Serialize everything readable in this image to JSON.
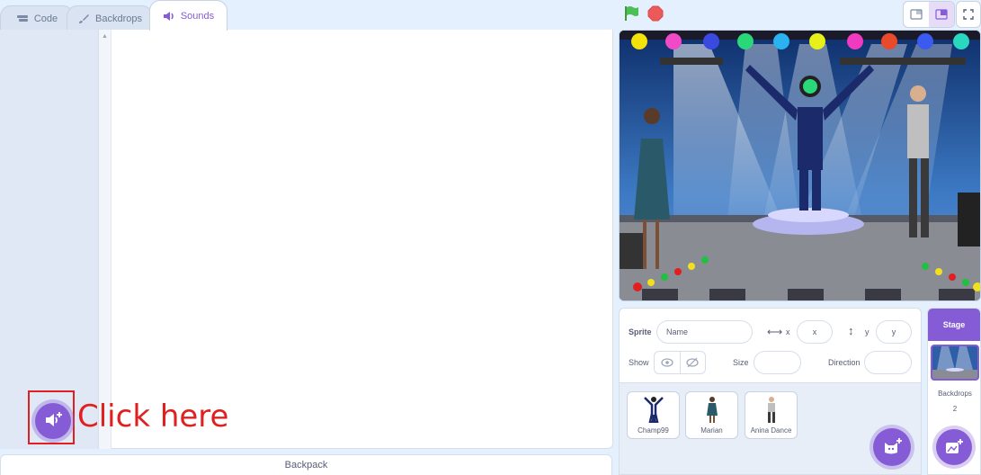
{
  "tabs": [
    {
      "label": "Code",
      "icon": "code-icon"
    },
    {
      "label": "Backdrops",
      "icon": "brush-icon"
    },
    {
      "label": "Sounds",
      "icon": "speaker-icon"
    }
  ],
  "active_tab": "Sounds",
  "annotation": {
    "text": "Click here",
    "color": "#e02020"
  },
  "backpack": {
    "label": "Backpack"
  },
  "sprite_info": {
    "sprite_label": "Sprite",
    "name_placeholder": "Name",
    "x_label": "x",
    "x_placeholder": "x",
    "y_label": "y",
    "y_placeholder": "y",
    "show_label": "Show",
    "size_label": "Size",
    "direction_label": "Direction"
  },
  "sprites": [
    {
      "name": "Champ99"
    },
    {
      "name": "Marian"
    },
    {
      "name": "Anina Dance"
    }
  ],
  "stage_pane": {
    "header": "Stage",
    "backdrops_label": "Backdrops",
    "backdrops_count": "2"
  },
  "colors": {
    "accent": "#855cd6",
    "background": "#e5f0ff",
    "flag": "#4cbf56",
    "stop": "#ec5959"
  }
}
